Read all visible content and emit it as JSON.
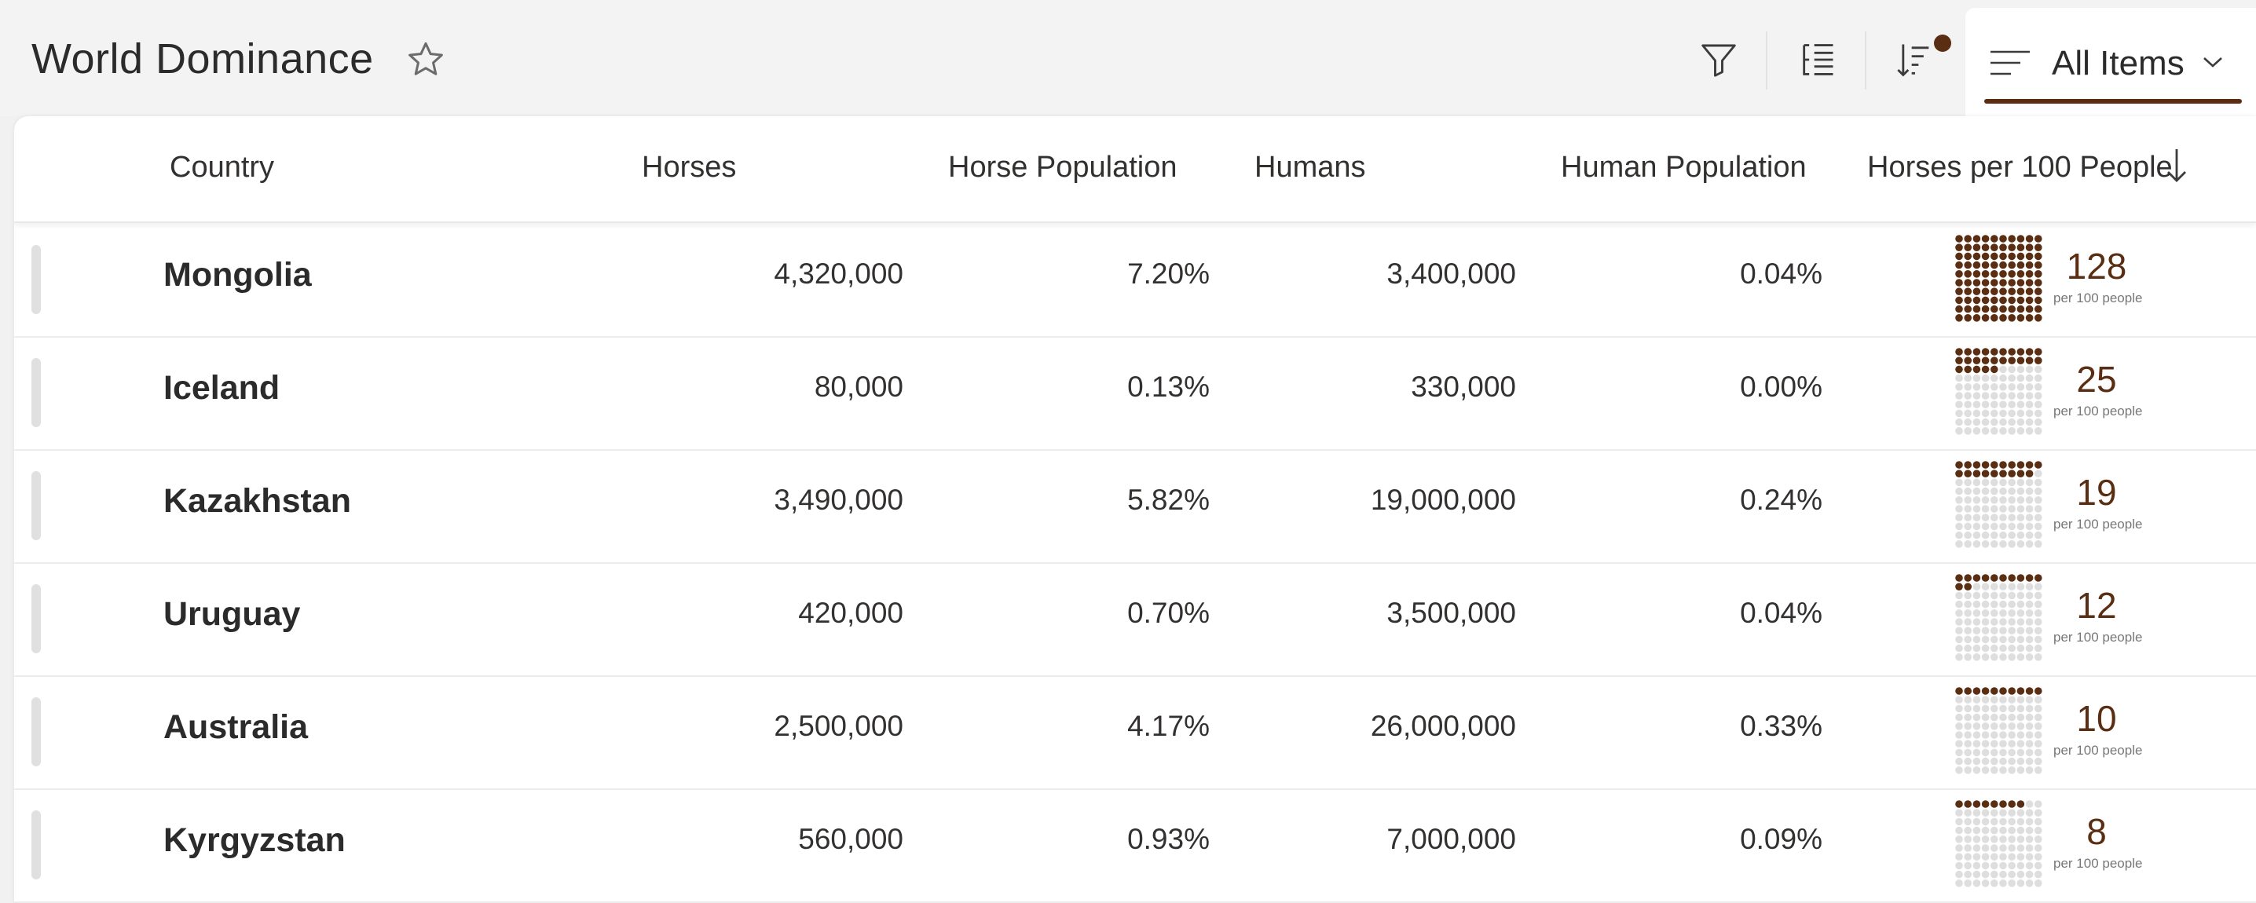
{
  "app": {
    "title": "World Dominance",
    "view_label": "All Items",
    "accent_color": "#5a2e12"
  },
  "toolbar": {
    "icons": [
      "filter-icon",
      "list-edit-icon",
      "sort-icon",
      "view-lines-icon",
      "chevron-down-icon",
      "star-icon"
    ]
  },
  "columns": [
    "Country",
    "Horses",
    "Horse Population",
    "Humans",
    "Human Population",
    "Horses per 100 People"
  ],
  "ratio_unit": "per 100 people",
  "rows": [
    {
      "country": "Mongolia",
      "horses": "4,320,000",
      "horse_pop": "7.20%",
      "humans": "3,400,000",
      "human_pop": "0.04%",
      "ratio": "128",
      "ratio_value": 128
    },
    {
      "country": "Iceland",
      "horses": "80,000",
      "horse_pop": "0.13%",
      "humans": "330,000",
      "human_pop": "0.00%",
      "ratio": "25",
      "ratio_value": 25
    },
    {
      "country": "Kazakhstan",
      "horses": "3,490,000",
      "horse_pop": "5.82%",
      "humans": "19,000,000",
      "human_pop": "0.24%",
      "ratio": "19",
      "ratio_value": 19
    },
    {
      "country": "Uruguay",
      "horses": "420,000",
      "horse_pop": "0.70%",
      "humans": "3,500,000",
      "human_pop": "0.04%",
      "ratio": "12",
      "ratio_value": 12
    },
    {
      "country": "Australia",
      "horses": "2,500,000",
      "horse_pop": "4.17%",
      "humans": "26,000,000",
      "human_pop": "0.33%",
      "ratio": "10",
      "ratio_value": 10
    },
    {
      "country": "Kyrgyzstan",
      "horses": "560,000",
      "horse_pop": "0.93%",
      "humans": "7,000,000",
      "human_pop": "0.09%",
      "ratio": "8",
      "ratio_value": 8
    }
  ]
}
